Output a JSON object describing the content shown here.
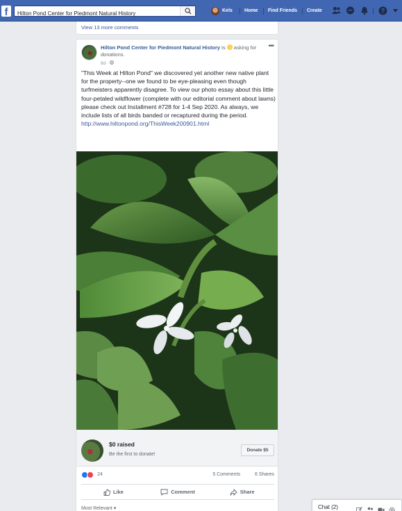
{
  "topbar": {
    "search_value": "Hilton Pond Center for Piedmont Natural History",
    "profile_name": "Kels",
    "home_label": "Home",
    "find_friends_label": "Find Friends",
    "create_label": "Create",
    "icons": [
      "facebook-logo-icon",
      "search-icon",
      "friend-requests-icon",
      "messenger-icon",
      "notifications-icon",
      "help-icon",
      "account-menu-icon"
    ]
  },
  "prev_post": {
    "more_comments": "View 13 more comments"
  },
  "post": {
    "page_name": "Hilton Pond Center for Piedmont Natural History",
    "activity_prefix": " is ",
    "activity": " asking for donations.",
    "time": "6d · ",
    "text": "\"This Week at Hilton Pond\" we discovered yet another new native plant for the property--one we found to be eye-pleasing even though turfmeisters apparently disagree. To view our photo essay about this little four-petaled wildflower (complete with our editorial comment about lawns) please check out Installment #728 for 1-4 Sep 2020. As always, we include lists of all birds banded or recaptured during the period. ",
    "link": "http://www.hiltonpond.org/ThisWeek200901.html"
  },
  "fundraiser": {
    "raised": "$0 raised",
    "subtitle": "Be the first to donate!",
    "donate_label": "Donate $5"
  },
  "stats": {
    "reactions_count": "24",
    "comments": "5 Comments",
    "shares": "6 Shares"
  },
  "actions": {
    "like": "Like",
    "comment": "Comment",
    "share": "Share"
  },
  "comment_filter": "Most Relevant",
  "chat": {
    "label": "Chat (2)"
  },
  "colors": {
    "brand_blue": "#4267b2",
    "link_blue": "#385898",
    "background": "#e9ebee"
  }
}
